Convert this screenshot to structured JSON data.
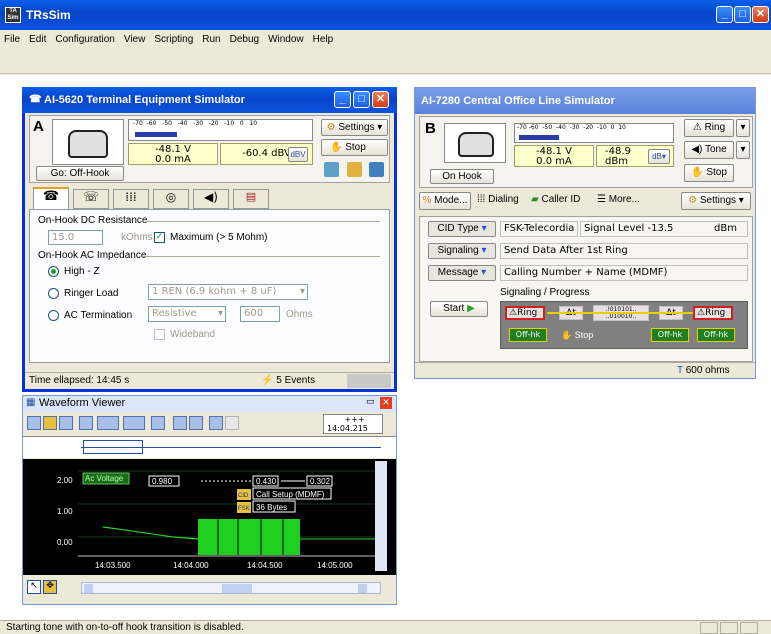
{
  "app": {
    "title": "TRsSim",
    "logo_text": "TA Sim"
  },
  "menu": [
    "File",
    "Edit",
    "Configuration",
    "View",
    "Scripting",
    "Run",
    "Debug",
    "Window",
    "Help"
  ],
  "left": {
    "title": "AI-5620  Terminal Equipment Simulator",
    "letter": "A",
    "meter_ticks": [
      "-70",
      "-60",
      "-50",
      "-40",
      "-30",
      "-20",
      "-10",
      "0",
      "10"
    ],
    "voltage": "-48.1  V",
    "current": "0.0 mA",
    "dbv": "-60.4 dBV",
    "settings_label": "Settings",
    "stop_label": "Stop",
    "go_offhook": "Go: Off-Hook",
    "onhook_dc_title": "On-Hook DC Resistance",
    "dc_value": "15.0",
    "dc_unit": "kOhms",
    "max_label": "Maximum (> 5 Mohm)",
    "onhook_ac_title": "On-Hook AC Impedance",
    "high_z": "High - Z",
    "ringer_load": "Ringer Load",
    "ringer_value": "1 REN (6.9 kohm + 8 uF)",
    "ac_termination": "AC Termination",
    "ac_value": "Resistive",
    "ac_ohms": "600",
    "ohms_unit": "Ohms",
    "wideband": "Wideband",
    "time_elapsed": "Time ellapsed:  14:45 s",
    "events": "5 Events"
  },
  "wave": {
    "title": "Waveform Viewer",
    "time": "14:04.215",
    "time_top": "+++",
    "y_labels": [
      "2.00",
      "1.00",
      "0.00"
    ],
    "x_labels": [
      "14:03.500",
      "14:04.000",
      "14:04.500",
      "14:05.000"
    ],
    "series_label": "Ac Voltage",
    "marks": [
      "0.980",
      "0.430",
      "0.302"
    ],
    "annot1": "Call Setup (MDMF)",
    "annot2": "36 Bytes",
    "cid_badge": "CID",
    "fsk_badge": "FSK"
  },
  "right": {
    "title": "AI-7280  Central Office Line Simulator",
    "letter": "B",
    "meter_ticks": [
      "-70",
      "-60",
      "-50",
      "-40",
      "-30",
      "-20",
      "-10",
      "0",
      "10"
    ],
    "voltage": "-48.1  V",
    "current": "0.0 mA",
    "dbm": "-48.9",
    "dbm_unit": "dBm",
    "ring_label": "Ring",
    "tone_label": "Tone",
    "stop_label": "Stop",
    "onhook": "On Hook",
    "mode": "Mode...",
    "dialing": "Dialing",
    "callerid": "Caller ID",
    "more": "More...",
    "settings": "Settings",
    "cid_type": "CID Type",
    "cid_value": "FSK-Telecordia",
    "signal_level": "Signal Level",
    "signal_value": "-13.5",
    "signal_unit": "dBm",
    "signaling": "Signaling",
    "signaling_value": "Send Data After 1st Ring",
    "message": "Message",
    "message_value": "Calling Number + Name (MDMF)",
    "start": "Start",
    "progress_title": "Signaling / Progress",
    "seq_ring1": "Ring",
    "seq_dt1": "Δt",
    "seq_data": ".!010101.. ..010010..",
    "seq_dt2": "Δt",
    "seq_ring2": "Ring",
    "offhk": "Off-hk",
    "stop_seq": "Stop",
    "offhk2": "Off-hk",
    "offhk3": "Off-hk",
    "status_ohms": "600 ohms"
  },
  "status_bar": "Starting tone with on-to-off hook transition is disabled."
}
